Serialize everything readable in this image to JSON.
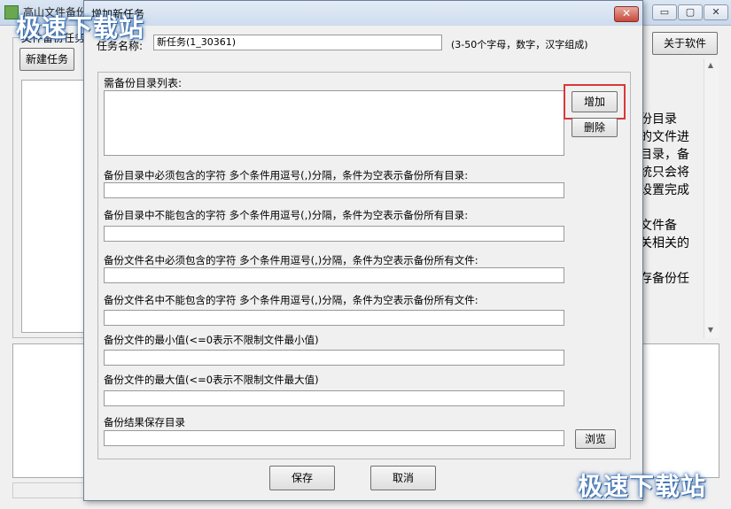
{
  "main_window": {
    "title": "高山文件备份",
    "group_label": "文件备份任务",
    "new_task_button": "新建任务",
    "about_button": "关于软件",
    "help_lines": [
      "份目录",
      "的文件进",
      "目录，备",
      "统只会将",
      "设置完成",
      "文件备",
      "关相关的",
      "存备份任"
    ],
    "win_buttons": [
      "▭",
      "▢",
      "✕"
    ]
  },
  "dialog": {
    "title": "增加新任务",
    "close_label": "✕",
    "task_name_label": "任务名称:",
    "task_name_value": "新任务(1_30361)",
    "task_name_hint": "(3-50个字母，数字，汉字组成)",
    "dir_list_label": "需备份目录列表:",
    "add_button": "增加",
    "delete_button": "删除",
    "fields": [
      {
        "label": "备份目录中必须包含的字符 多个条件用逗号(,)分隔，条件为空表示备份所有目录:",
        "value": ""
      },
      {
        "label": "备份目录中不能包含的字符 多个条件用逗号(,)分隔，条件为空表示备份所有目录:",
        "value": ""
      },
      {
        "label": "备份文件名中必须包含的字符 多个条件用逗号(,)分隔，条件为空表示备份所有文件:",
        "value": ""
      },
      {
        "label": "备份文件名中不能包含的字符 多个条件用逗号(,)分隔，条件为空表示备份所有文件:",
        "value": ""
      },
      {
        "label": "备份文件的最小值(<=0表示不限制文件最小值)",
        "value": ""
      },
      {
        "label": "备份文件的最大值(<=0表示不限制文件最大值)",
        "value": ""
      },
      {
        "label": "备份结果保存目录",
        "value": ""
      }
    ],
    "browse_button": "浏览",
    "save_button": "保存",
    "cancel_button": "取消"
  },
  "watermark": {
    "top_left": "极速下载站",
    "bottom_right": "极速下载站"
  },
  "colors": {
    "highlight": "#d9383a",
    "titlebar": "#cddcee"
  }
}
